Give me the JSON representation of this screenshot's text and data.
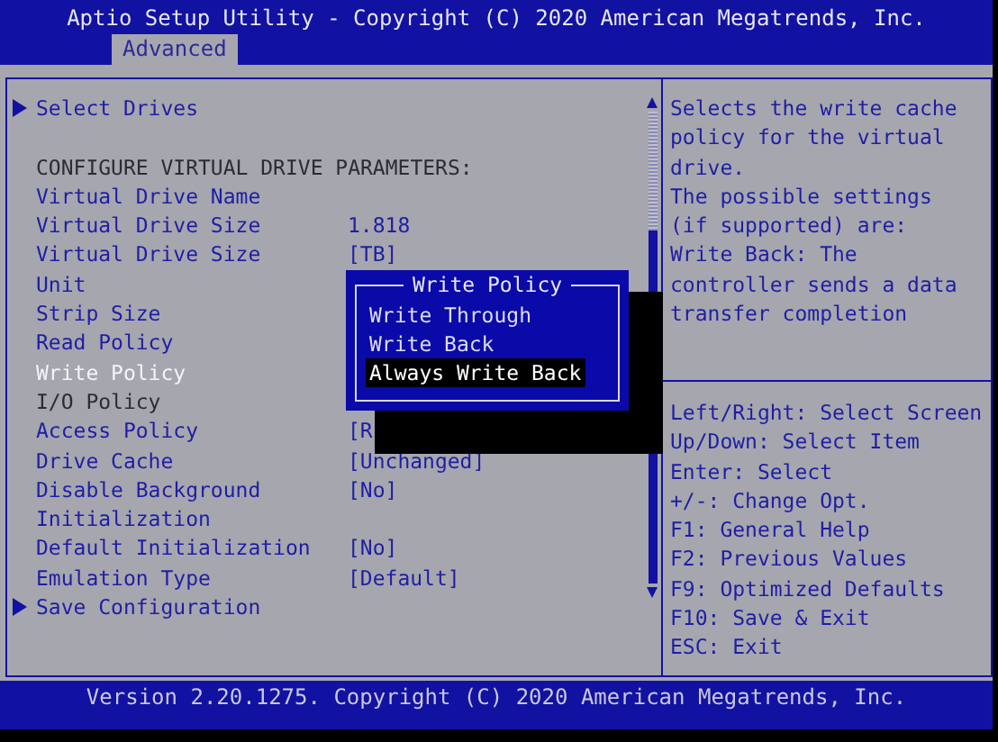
{
  "title": "Aptio Setup Utility - Copyright (C) 2020 American Megatrends, Inc.",
  "tabs": [
    {
      "label": "Advanced",
      "selected": true
    }
  ],
  "menu": [
    {
      "kind": "submenu",
      "label": "Select Drives",
      "selected": false,
      "disabled": false
    },
    {
      "kind": "header",
      "label": "CONFIGURE VIRTUAL DRIVE PARAMETERS:"
    },
    {
      "kind": "setting",
      "label": "Virtual Drive Name",
      "selected": false,
      "disabled": false
    },
    {
      "kind": "setting",
      "label": "Virtual Drive Size",
      "value": "1.818",
      "selected": false,
      "disabled": false
    },
    {
      "kind": "setting",
      "label": "Virtual Drive Size",
      "value": "[TB]",
      "selected": false,
      "disabled": false
    },
    {
      "kind": "setting",
      "label": "Unit",
      "selected": false,
      "disabled": false
    },
    {
      "kind": "setting",
      "label": "Strip Size",
      "selected": false,
      "disabled": false
    },
    {
      "kind": "setting",
      "label": "Read Policy",
      "selected": false,
      "disabled": false
    },
    {
      "kind": "setting",
      "label": "Write Policy",
      "selected": true,
      "disabled": false
    },
    {
      "kind": "setting",
      "label": "I/O Policy",
      "selected": false,
      "disabled": true
    },
    {
      "kind": "setting",
      "label": "Access Policy",
      "value": "[R",
      "selected": false,
      "disabled": false
    },
    {
      "kind": "setting",
      "label": "Drive Cache",
      "value": "[Unchanged]",
      "selected": false,
      "disabled": false
    },
    {
      "kind": "setting",
      "label": "Disable Background Initialization",
      "value": "[No]",
      "selected": false,
      "disabled": false
    },
    {
      "kind": "setting",
      "label": "Default Initialization",
      "value": "[No]",
      "selected": false,
      "disabled": false
    },
    {
      "kind": "setting",
      "label": "Emulation Type",
      "value": "[Default]",
      "selected": false,
      "disabled": false
    },
    {
      "kind": "submenu",
      "label": "Save Configuration",
      "selected": false,
      "disabled": false
    }
  ],
  "popup": {
    "title": "Write Policy",
    "options": [
      {
        "label": "Write Through",
        "selected": false
      },
      {
        "label": "Write Back",
        "selected": false
      },
      {
        "label": "Always Write Back",
        "selected": true
      }
    ]
  },
  "help": {
    "description": [
      "Selects the write cache policy for the virtual drive.",
      "The possible settings (if supported) are:",
      "Write Back: The controller sends a data transfer completion"
    ],
    "keys": [
      "Left/Right: Select Screen",
      "Up/Down: Select Item",
      "Enter: Select",
      "+/-: Change Opt.",
      "F1: General Help",
      "F2: Previous Values",
      "F9: Optimized Defaults",
      "F10: Save & Exit",
      "ESC: Exit"
    ]
  },
  "footer": "Version 2.20.1275. Copyright (C) 2020 American Megatrends, Inc."
}
